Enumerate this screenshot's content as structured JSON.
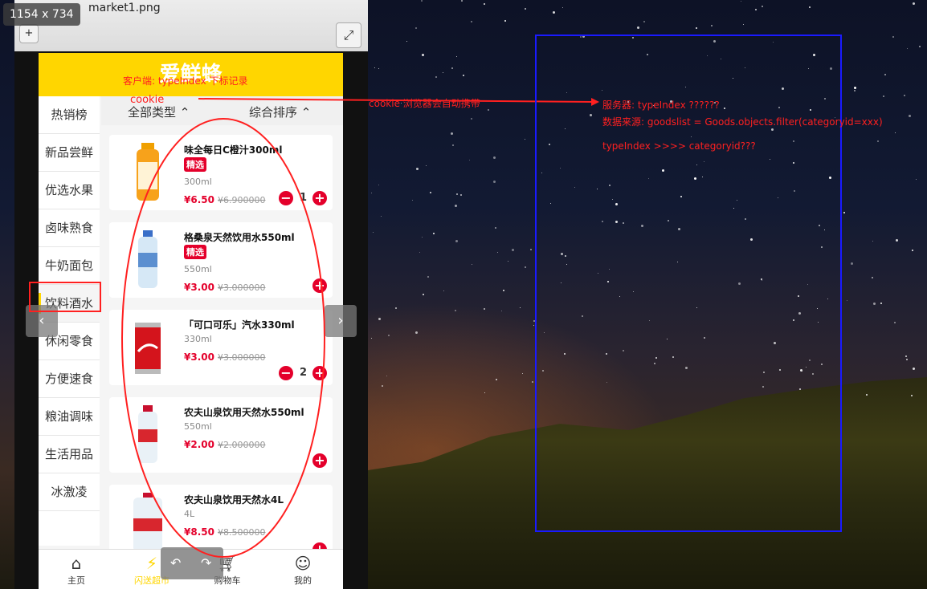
{
  "viewer": {
    "size_badge": "1154 x 734",
    "filename": "market1.png",
    "zoom_in_icon": "plus-icon",
    "fullscreen_icon": "expand-icon"
  },
  "app": {
    "title": "爱鲜蜂",
    "filter": {
      "category_label": "全部类型",
      "sort_label": "综合排序"
    },
    "sidebar": [
      "热销榜",
      "新品尝鲜",
      "优选水果",
      "卤味熟食",
      "牛奶面包",
      "饮料酒水",
      "休闲零食",
      "方便速食",
      "粮油调味",
      "生活用品",
      "冰激凌"
    ],
    "active_index": 5,
    "goods": [
      {
        "name": "味全每日C橙汁300ml",
        "tag": "精选",
        "spec": "300ml",
        "price": "¥6.50",
        "old_price": "¥6.900000",
        "qty": "1"
      },
      {
        "name": "格桑泉天然饮用水550ml",
        "tag": "精选",
        "spec": "550ml",
        "price": "¥3.00",
        "old_price": "¥3.000000",
        "qty": ""
      },
      {
        "name": "「可口可乐」汽水330ml",
        "tag": "",
        "spec": "330ml",
        "price": "¥3.00",
        "old_price": "¥3.000000",
        "qty": "2"
      },
      {
        "name": "农夫山泉饮用天然水550ml",
        "tag": "",
        "spec": "550ml",
        "price": "¥2.00",
        "old_price": "¥2.000000",
        "qty": ""
      },
      {
        "name": "农夫山泉饮用天然水4L",
        "tag": "",
        "spec": "4L",
        "price": "¥8.50",
        "old_price": "¥8.500000",
        "qty": ""
      }
    ],
    "tabs": [
      {
        "label": "主页",
        "icon": "home-icon"
      },
      {
        "label": "闪送超市",
        "icon": "lightning-icon"
      },
      {
        "label": "购物车",
        "icon": "cart-icon"
      },
      {
        "label": "我的",
        "icon": "user-icon"
      }
    ]
  },
  "annotations": {
    "client": "客户端: typeIndex 下标记录",
    "cookie": "cookie",
    "cookie_note": "cookie 浏览器会自动携带",
    "server": "服务器: typeIndex  ??????",
    "data_source": "数据来源: goodslist = Goods.objects.filter(categoryid=xxx)",
    "mapping": "typeIndex >>>> categoryid???"
  },
  "colors": {
    "accent": "#ffd600",
    "price": "#e4002b",
    "annotation": "#ff2020",
    "box": "#1a1aff"
  }
}
